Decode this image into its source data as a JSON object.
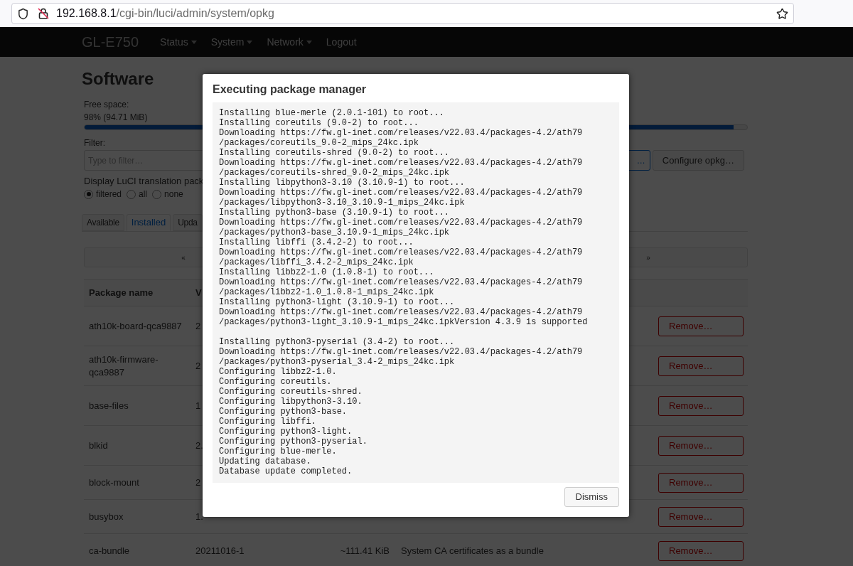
{
  "browser": {
    "url_host": "192.168.8.1",
    "url_path": "/cgi-bin/luci/admin/system/opkg"
  },
  "navbar": {
    "brand": "GL-E750",
    "menu": [
      {
        "label": "Status",
        "dropdown": true
      },
      {
        "label": "System",
        "dropdown": true
      },
      {
        "label": "Network",
        "dropdown": true
      },
      {
        "label": "Logout",
        "dropdown": false
      }
    ]
  },
  "page": {
    "title": "Software",
    "free_space": {
      "label": "Free space:",
      "reading": "98% (94.71 MiB)",
      "level": 0.98
    },
    "filter": {
      "label": "Filter:",
      "placeholder": "Type to filter…"
    },
    "actions": [
      {
        "label": "…",
        "kind": "primary"
      },
      {
        "label": "Configure opkg…",
        "kind": "default"
      }
    ],
    "translation": {
      "label": "Display LuCI translation pack",
      "options": [
        {
          "label": "filtered",
          "selected": true
        },
        {
          "label": "all",
          "selected": false
        },
        {
          "label": "none",
          "selected": false
        }
      ]
    },
    "tabs": [
      {
        "label": "Available",
        "selected": false
      },
      {
        "label": "Installed",
        "selected": true
      },
      {
        "label": "Upda",
        "selected": false
      }
    ],
    "pager": {
      "prev": "«",
      "next": "»"
    },
    "table": {
      "columns": [
        "Package name",
        "V"
      ],
      "rows": [
        {
          "name": "ath10k-board-qca9887",
          "version": "2",
          "action": "Remove…"
        },
        {
          "name": "ath10k-firmware-qca9887",
          "version": "2",
          "action": "Remove…"
        },
        {
          "name": "base-files",
          "version": "1",
          "action": "Remove…"
        },
        {
          "name": "blkid",
          "version": "2.",
          "action": "Remove…"
        },
        {
          "name": "block-mount",
          "version": "2",
          "action": "Remove…"
        },
        {
          "name": "busybox",
          "version": "1.",
          "action": "Remove…"
        },
        {
          "name": "ca-bundle",
          "version": "20211016-1",
          "size": "~111.41 KiB",
          "description": "System CA certificates as a bundle",
          "action": "Remove…"
        }
      ]
    }
  },
  "dialog": {
    "title": "Executing package manager",
    "log": "Installing blue-merle (2.0.1-101) to root...\nInstalling coreutils (9.0-2) to root...\nDownloading https://fw.gl-inet.com/releases/v22.03.4/packages-4.2/ath79\n/packages/coreutils_9.0-2_mips_24kc.ipk\nInstalling coreutils-shred (9.0-2) to root...\nDownloading https://fw.gl-inet.com/releases/v22.03.4/packages-4.2/ath79\n/packages/coreutils-shred_9.0-2_mips_24kc.ipk\nInstalling libpython3-3.10 (3.10.9-1) to root...\nDownloading https://fw.gl-inet.com/releases/v22.03.4/packages-4.2/ath79\n/packages/libpython3-3.10_3.10.9-1_mips_24kc.ipk\nInstalling python3-base (3.10.9-1) to root...\nDownloading https://fw.gl-inet.com/releases/v22.03.4/packages-4.2/ath79\n/packages/python3-base_3.10.9-1_mips_24kc.ipk\nInstalling libffi (3.4.2-2) to root...\nDownloading https://fw.gl-inet.com/releases/v22.03.4/packages-4.2/ath79\n/packages/libffi_3.4.2-2_mips_24kc.ipk\nInstalling libbz2-1.0 (1.0.8-1) to root...\nDownloading https://fw.gl-inet.com/releases/v22.03.4/packages-4.2/ath79\n/packages/libbz2-1.0_1.0.8-1_mips_24kc.ipk\nInstalling python3-light (3.10.9-1) to root...\nDownloading https://fw.gl-inet.com/releases/v22.03.4/packages-4.2/ath79\n/packages/python3-light_3.10.9-1_mips_24kc.ipkVersion 4.3.9 is supported\n\nInstalling python3-pyserial (3.4-2) to root...\nDownloading https://fw.gl-inet.com/releases/v22.03.4/packages-4.2/ath79\n/packages/python3-pyserial_3.4-2_mips_24kc.ipk\nConfiguring libbz2-1.0.\nConfiguring coreutils.\nConfiguring coreutils-shred.\nConfiguring libpython3-3.10.\nConfiguring python3-base.\nConfiguring libffi.\nConfiguring python3-light.\nConfiguring python3-pyserial.\nConfiguring blue-merle.\nUpdating database.\nDatabase update completed.",
    "button": "Dismiss"
  }
}
